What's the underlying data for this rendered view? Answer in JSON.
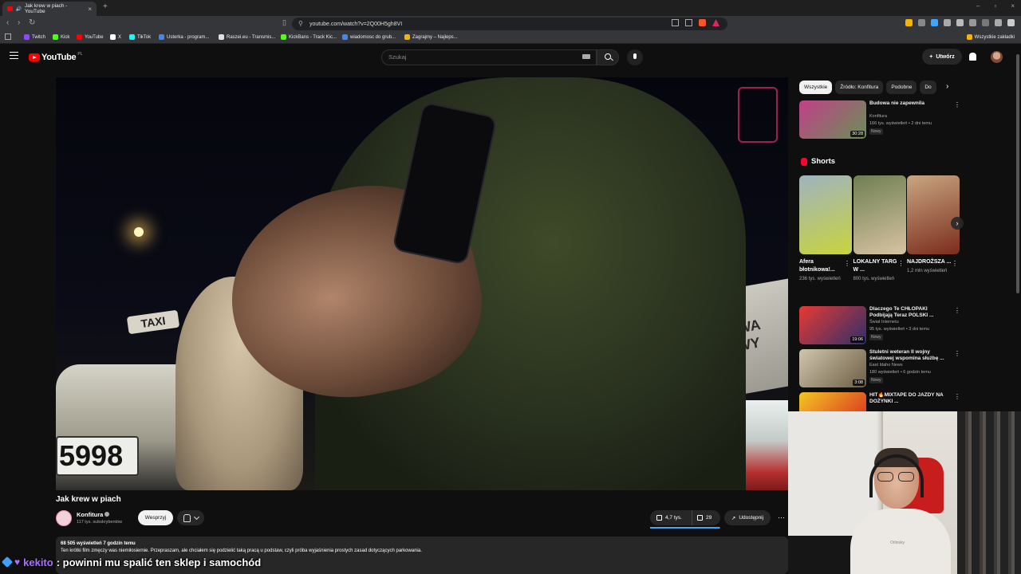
{
  "browser": {
    "tab_title": "Jak krew w piach - YouTube",
    "url": "youtube.com/watch?v=2Q00H5gh8VI",
    "bookmarks": [
      {
        "label": "Twitch",
        "color": "#9146ff"
      },
      {
        "label": "Kick",
        "color": "#53fc18"
      },
      {
        "label": "YouTube",
        "color": "#ff0000"
      },
      {
        "label": "X",
        "color": "#ffffff"
      },
      {
        "label": "TikTok",
        "color": "#25f4ee"
      },
      {
        "label": "Usterka - program...",
        "color": "#4285f4"
      },
      {
        "label": "Raszei.eu - Transmis...",
        "color": "#e0e0e0"
      },
      {
        "label": "KickBans - Track Kic...",
        "color": "#53fc18"
      },
      {
        "label": "wiadomosc do grub...",
        "color": "#4285f4"
      },
      {
        "label": "Zagrajmy – Najleps...",
        "color": "#f4b400"
      }
    ],
    "all_bookmarks": "Wszystkie zakładki"
  },
  "yt": {
    "logo": "YouTube",
    "country": "PL",
    "search_placeholder": "Szukaj",
    "create_label": "Utwórz"
  },
  "video": {
    "title": "Jak krew w piach",
    "channel": "Konfitura",
    "subscribers": "117 tys. subskrybentów",
    "support_label": "Wesprzyj",
    "likes": "4,7 tys.",
    "dislikes": "29",
    "like_fraction": 0.99,
    "share_label": "Udostępnij",
    "stats": "68 505 wyświetleń  7 godzin temu",
    "description": "Ten krótki film zmęczy was niemiłosiernie. Przepraszam, ale chciałem się podzielić taką pracą u podstaw, czyli próba wyjaśnienia prostych zasad dotyczących parkowania.",
    "scene_taxi": "TAXI",
    "scene_plate": "5998",
    "scene_shop": "OWOCE\nWARZYWA\nDOSTAWY"
  },
  "chips": [
    "Wszystkie",
    "Źródło: Konfitura",
    "Podobne",
    "Do"
  ],
  "recommendations_top": [
    {
      "title": "Budowa nie zapewnila",
      "channel": "Konfitura",
      "meta": "166 tys. wyświetleń • 2 dni temu",
      "badge": "Nowy",
      "duration": "30:28",
      "color1": "#c23f8a",
      "color2": "#6a8f57"
    }
  ],
  "shorts": {
    "heading": "Shorts",
    "items": [
      {
        "title": "Afera błotnikowa!...",
        "views": "236 tys. wyświetleń",
        "color1": "#9fb3bf",
        "color2": "#c9d43c"
      },
      {
        "title": "LOKALNY TARG W ...",
        "views": "800 tys. wyświetleń",
        "color1": "#6e7f52",
        "color2": "#d8c3a2"
      },
      {
        "title": "NAJDROŻSZA ...",
        "views": "1,2 mln wyświetleń",
        "color1": "#c9a682",
        "color2": "#7a2c1c"
      }
    ]
  },
  "recommendations": [
    {
      "title": "Dlaczego Te CHŁOPAKI Podbijają Teraz POLSKI ...",
      "channel": "Świat Internetu",
      "meta": "95 tys. wyświetleń • 3 dni temu",
      "badge": "Nowy",
      "duration": "19:06",
      "color1": "#e63a33",
      "color2": "#2f2f6a"
    },
    {
      "title": "Stuletni weteran II wojny światowej wspomina służbę ...",
      "channel": "East Idaho News",
      "meta": "180 wyświetleń • 6 godzin temu",
      "badge": "Nowy",
      "duration": "3:08",
      "color1": "#cfc6ae",
      "color2": "#6d5e44"
    },
    {
      "title": "HIT🔥MIXTAPE DO JAZDY NA DOŻYNKI ...",
      "channel": "",
      "meta": "",
      "badge": "",
      "duration": "",
      "color1": "#f3c623",
      "color2": "#d7261e"
    }
  ],
  "chat": {
    "user": "kekito",
    "message": ": powinni mu spalić ten sklep i samochód"
  },
  "webcam": {
    "shirt_text": "Orlinsky"
  }
}
